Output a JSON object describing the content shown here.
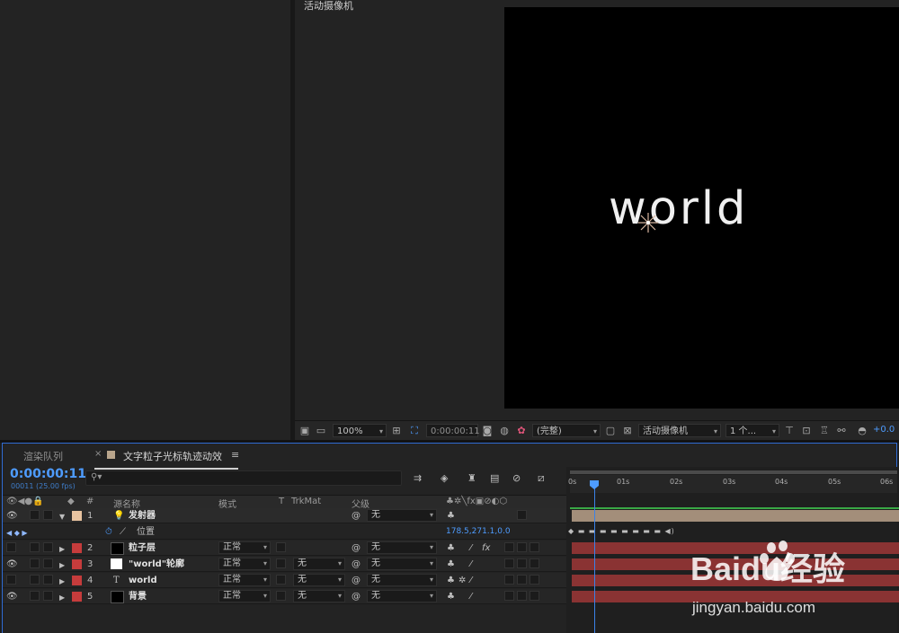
{
  "viewer": {
    "title": "活动摄像机",
    "canvas_text": "world",
    "toolbar": {
      "zoom": "100%",
      "timecode": "0:00:00:11",
      "resolution": "(完整)",
      "camera": "活动摄像机",
      "views": "1 个...",
      "exposure": "+0.0"
    }
  },
  "timeline": {
    "tabs": {
      "render_queue": "渲染队列",
      "comp": "文字粒子光标轨迹动效"
    },
    "timecode": "0:00:00:11",
    "frame_info": "00011 (25.00 fps)",
    "columns": {
      "num": "#",
      "source_name": "源名称",
      "mode": "模式",
      "t": "T",
      "trkmat": "TrkMat",
      "parent": "父级"
    },
    "ruler_ticks": [
      "0s",
      "01s",
      "02s",
      "03s",
      "04s",
      "05s",
      "06s"
    ],
    "layers": [
      {
        "num": "1",
        "name": "发射器",
        "mode": "",
        "trkmat": "",
        "parent": "无",
        "label_color": "#e8c3a0"
      },
      {
        "num": "2",
        "name": "粒子层",
        "mode": "正常",
        "trkmat": "",
        "parent": "无",
        "label_color": "#c63c3c"
      },
      {
        "num": "3",
        "name": "\"world\"轮廓",
        "mode": "正常",
        "trkmat": "无",
        "parent": "无",
        "label_color": "#c63c3c"
      },
      {
        "num": "4",
        "name": "world",
        "mode": "正常",
        "trkmat": "无",
        "parent": "无",
        "label_color": "#c63c3c"
      },
      {
        "num": "5",
        "name": "背景",
        "mode": "正常",
        "trkmat": "无",
        "parent": "无",
        "label_color": "#c63c3c"
      }
    ],
    "property": {
      "name": "位置",
      "value": "178.5,271.1,0.0"
    }
  },
  "watermark": {
    "brand": "Baidu经验",
    "url": "jingyan.baidu.com"
  },
  "colors": {
    "accent": "#4e9cff",
    "layer_red": "#c63c3c",
    "layer_tan": "#e8c3a0",
    "work_area_green": "#39a845"
  }
}
